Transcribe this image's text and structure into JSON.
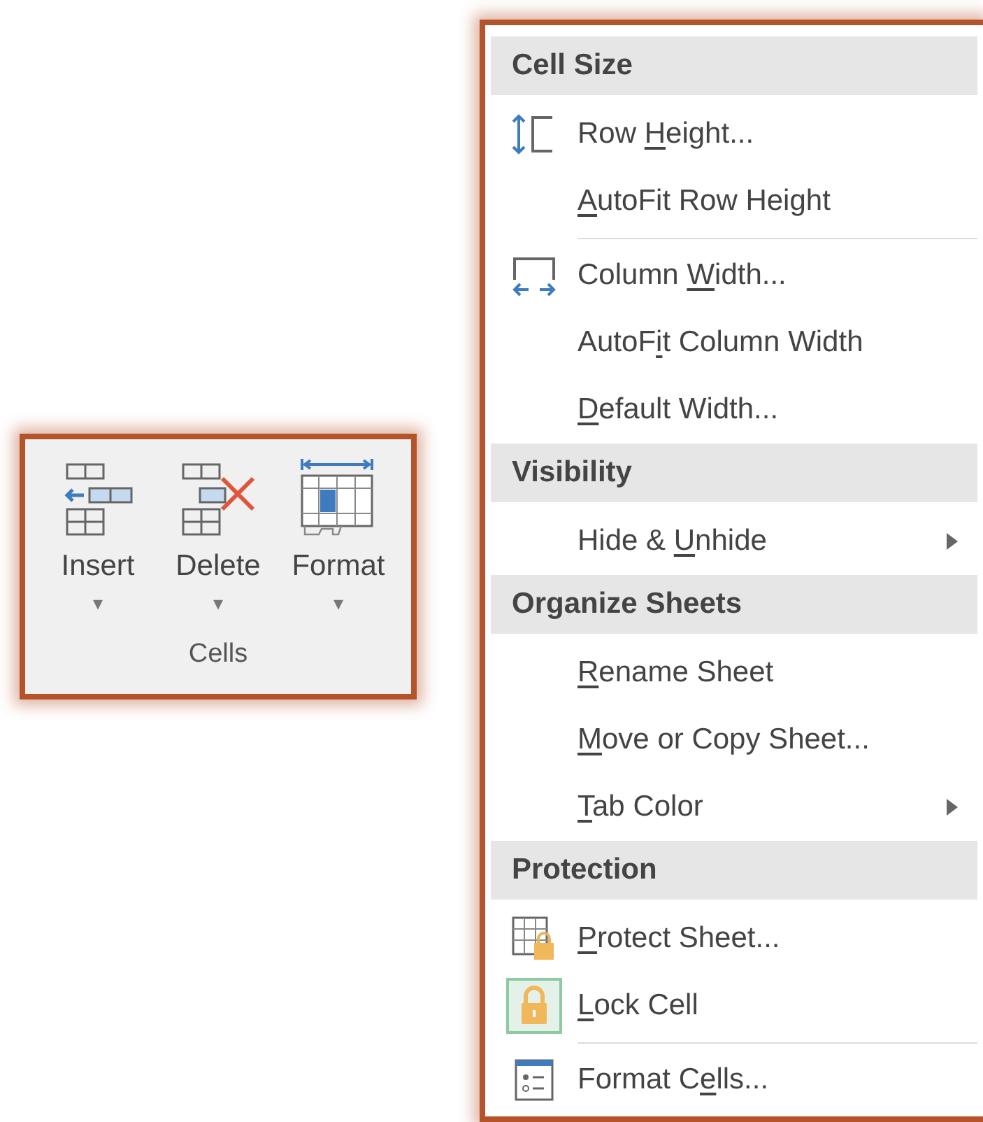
{
  "ribbon_group": {
    "label": "Cells",
    "buttons": [
      {
        "label": "Insert",
        "caret": "▾"
      },
      {
        "label": "Delete",
        "caret": "▾"
      },
      {
        "label": "Format",
        "caret": "▾"
      }
    ]
  },
  "menu": {
    "sections": [
      {
        "header": "Cell Size",
        "items": [
          {
            "kind": "item",
            "label": {
              "before": "Row ",
              "key": "H",
              "after": "eight..."
            },
            "checked": false,
            "submenu": false
          },
          {
            "kind": "item",
            "label": {
              "key": "A",
              "after": "utoFit Row Height"
            },
            "checked": false,
            "submenu": false
          },
          {
            "kind": "separator"
          },
          {
            "kind": "item",
            "label": {
              "before": "Column ",
              "key": "W",
              "after": "idth..."
            },
            "checked": false,
            "submenu": false
          },
          {
            "kind": "item",
            "label": {
              "before": "AutoF",
              "key": "i",
              "after": "t Column Width"
            },
            "checked": false,
            "submenu": false
          },
          {
            "kind": "item",
            "label": {
              "key": "D",
              "after": "efault Width..."
            },
            "checked": false,
            "submenu": false
          }
        ]
      },
      {
        "header": "Visibility",
        "items": [
          {
            "kind": "item",
            "label": {
              "before": "Hide & ",
              "key": "U",
              "after": "nhide"
            },
            "checked": false,
            "submenu": true
          }
        ]
      },
      {
        "header": "Organize Sheets",
        "items": [
          {
            "kind": "item",
            "label": {
              "key": "R",
              "after": "ename Sheet"
            },
            "checked": false,
            "submenu": false
          },
          {
            "kind": "item",
            "label": {
              "key": "M",
              "after": "ove or Copy Sheet..."
            },
            "checked": false,
            "submenu": false
          },
          {
            "kind": "item",
            "label": {
              "key": "T",
              "after": "ab Color"
            },
            "checked": false,
            "submenu": true
          }
        ]
      },
      {
        "header": "Protection",
        "items": [
          {
            "kind": "item",
            "label": {
              "key": "P",
              "after": "rotect Sheet..."
            },
            "checked": false,
            "submenu": false
          },
          {
            "kind": "item",
            "label": {
              "key": "L",
              "after": "ock Cell"
            },
            "checked": true,
            "submenu": false
          },
          {
            "kind": "separator"
          },
          {
            "kind": "item",
            "label": {
              "before": "Format C",
              "key": "e",
              "after": "lls..."
            },
            "checked": false,
            "submenu": false
          }
        ]
      }
    ]
  }
}
